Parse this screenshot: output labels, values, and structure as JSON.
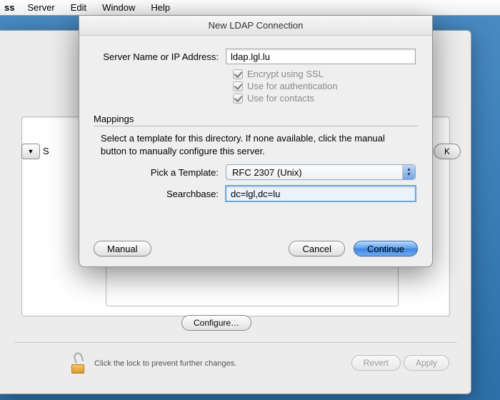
{
  "menubar": {
    "items": [
      "ss",
      "Server",
      "Edit",
      "Window",
      "Help"
    ]
  },
  "back_window": {
    "dropdown_glyph": "▼",
    "partial_label": "S",
    "ok_label": "K",
    "configure_label": "Configure…",
    "lock_text": "Click the lock to prevent further changes.",
    "revert_label": "Revert",
    "apply_label": "Apply"
  },
  "sheet": {
    "title": "New LDAP Connection",
    "server_label": "Server Name or IP Address:",
    "server_value": "ldap.lgl.lu",
    "checks": {
      "encrypt": "Encrypt using SSL",
      "auth": "Use for authentication",
      "contacts": "Use for contacts"
    },
    "mappings_title": "Mappings",
    "mappings_desc": "Select a template for this directory.  If none available, click the manual button to manually configure this server.",
    "template_label": "Pick a Template:",
    "template_value": "RFC 2307 (Unix)",
    "searchbase_label": "Searchbase:",
    "searchbase_value": "dc=lgl,dc=lu",
    "manual_label": "Manual",
    "cancel_label": "Cancel",
    "continue_label": "Continue"
  }
}
